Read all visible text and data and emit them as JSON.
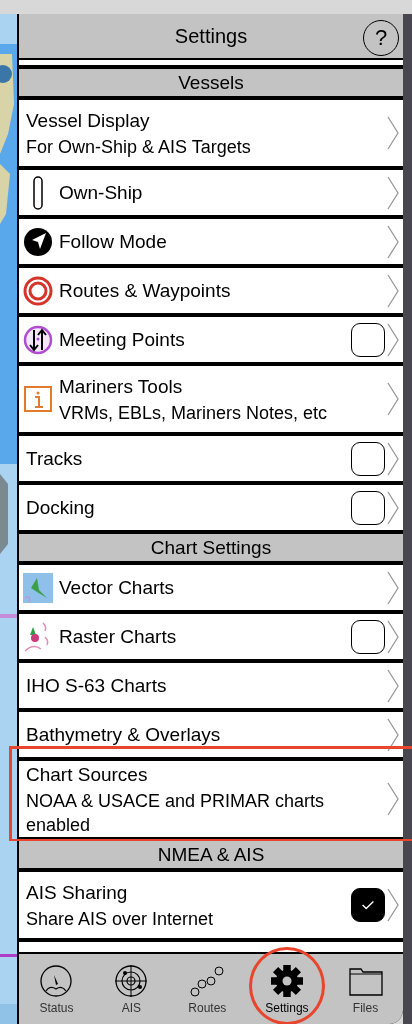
{
  "header": {
    "title": "Settings",
    "help": "?"
  },
  "sections": [
    {
      "title": "Vessels",
      "rows": [
        {
          "kind": "plain",
          "title": "Vessel Display",
          "subtitle": "For Own-Ship & AIS Targets"
        },
        {
          "kind": "ship",
          "title": "Own-Ship"
        },
        {
          "kind": "follow",
          "title": "Follow Mode"
        },
        {
          "kind": "routes",
          "title": "Routes & Waypoints"
        },
        {
          "kind": "meeting",
          "title": "Meeting Points",
          "checked": false
        },
        {
          "kind": "tools",
          "title": "Mariners Tools",
          "subtitle": "VRMs, EBLs, Mariners Notes, etc"
        },
        {
          "kind": "plain",
          "title": "Tracks",
          "checked": false
        },
        {
          "kind": "plain",
          "title": "Docking",
          "checked": false
        }
      ]
    },
    {
      "title": "Chart Settings",
      "rows": [
        {
          "kind": "vector-chart",
          "title": "Vector Charts"
        },
        {
          "kind": "raster-chart",
          "title": "Raster Charts",
          "checked": false
        },
        {
          "kind": "plain",
          "title": "IHO S-63 Charts"
        },
        {
          "kind": "plain",
          "title": "Bathymetry & Overlays"
        },
        {
          "kind": "plain",
          "title": "Chart Sources",
          "subtitle": "NOAA & USACE and PRIMAR charts enabled",
          "highlighted": true
        }
      ]
    },
    {
      "title": "NMEA & AIS",
      "rows": [
        {
          "kind": "plain",
          "title": "AIS Sharing",
          "subtitle": "Share AIS over Internet",
          "checked": true
        }
      ]
    }
  ],
  "tabs": [
    {
      "kind": "gauge",
      "label": "Status",
      "selected": false
    },
    {
      "kind": "radar",
      "label": "AIS",
      "selected": false
    },
    {
      "kind": "route",
      "label": "Routes",
      "selected": false
    },
    {
      "kind": "gear",
      "label": "Settings",
      "selected": true,
      "circled": true
    },
    {
      "kind": "folder",
      "label": "Files",
      "selected": false
    }
  ]
}
